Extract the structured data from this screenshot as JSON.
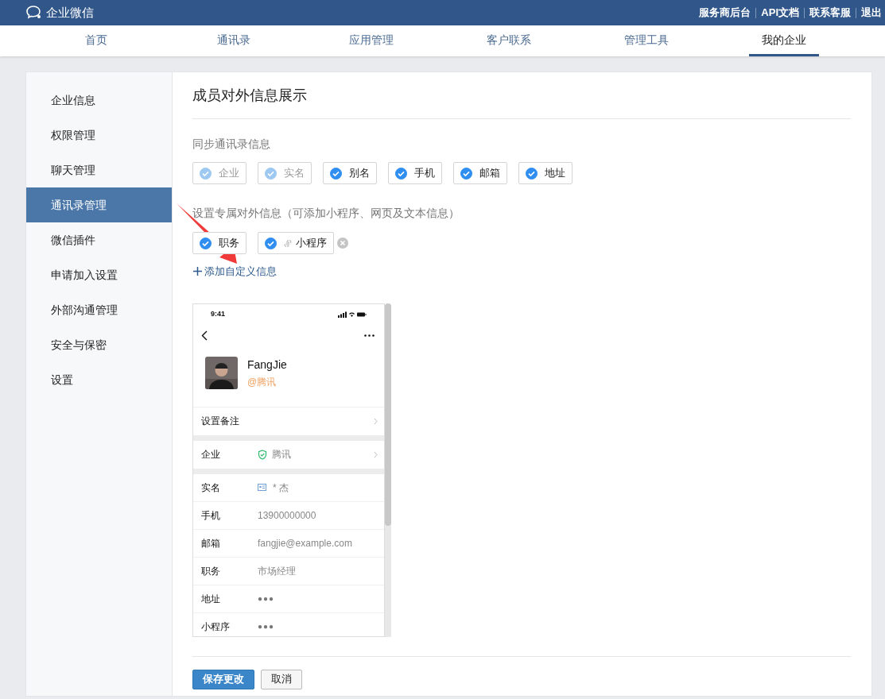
{
  "brand": {
    "name": "企业微信"
  },
  "header_links": [
    "服务商后台",
    "API文档",
    "联系客服",
    "退出"
  ],
  "nav_tabs": [
    {
      "label": "首页",
      "selected": false
    },
    {
      "label": "通讯录",
      "selected": false
    },
    {
      "label": "应用管理",
      "selected": false
    },
    {
      "label": "客户联系",
      "selected": false
    },
    {
      "label": "管理工具",
      "selected": false
    },
    {
      "label": "我的企业",
      "selected": true
    }
  ],
  "sidebar": {
    "items": [
      {
        "label": "企业信息",
        "selected": false
      },
      {
        "label": "权限管理",
        "selected": false
      },
      {
        "label": "聊天管理",
        "selected": false
      },
      {
        "label": "通讯录管理",
        "selected": true
      },
      {
        "label": "微信插件",
        "selected": false
      },
      {
        "label": "申请加入设置",
        "selected": false
      },
      {
        "label": "外部沟通管理",
        "selected": false
      },
      {
        "label": "安全与保密",
        "selected": false
      },
      {
        "label": "设置",
        "selected": false
      }
    ]
  },
  "page_title": "成员对外信息展示",
  "sync_section": {
    "label": "同步通讯录信息",
    "options": [
      {
        "label": "企业",
        "checked": true,
        "disabled": true
      },
      {
        "label": "实名",
        "checked": true,
        "disabled": true
      },
      {
        "label": "别名",
        "checked": true,
        "disabled": false
      },
      {
        "label": "手机",
        "checked": true,
        "disabled": false
      },
      {
        "label": "邮箱",
        "checked": true,
        "disabled": false
      },
      {
        "label": "地址",
        "checked": true,
        "disabled": false
      }
    ]
  },
  "custom_section": {
    "label": "设置专属对外信息（可添加小程序、网页及文本信息）",
    "items": [
      {
        "label": "职务",
        "checked": true,
        "kind": "field"
      },
      {
        "label": "小程序",
        "checked": true,
        "kind": "miniprogram"
      }
    ]
  },
  "add_link": "添加自定义信息",
  "preview": {
    "time": "9:41",
    "name": "FangJie",
    "company": "@腾讯",
    "remark": "设置备注",
    "company_row": {
      "label": "企业",
      "value": "腾讯"
    },
    "rows": [
      {
        "label": "实名",
        "value": "* 杰",
        "kind": "realname"
      },
      {
        "label": "手机",
        "value": "13900000000",
        "kind": "text"
      },
      {
        "label": "邮箱",
        "value": "fangjie@example.com",
        "kind": "text"
      },
      {
        "label": "职务",
        "value": "市场经理",
        "kind": "text"
      },
      {
        "label": "地址",
        "value": "●●●",
        "kind": "masked"
      },
      {
        "label": "小程序",
        "value": "●●●",
        "kind": "masked"
      }
    ]
  },
  "buttons": {
    "save": "保存更改",
    "cancel": "取消"
  }
}
